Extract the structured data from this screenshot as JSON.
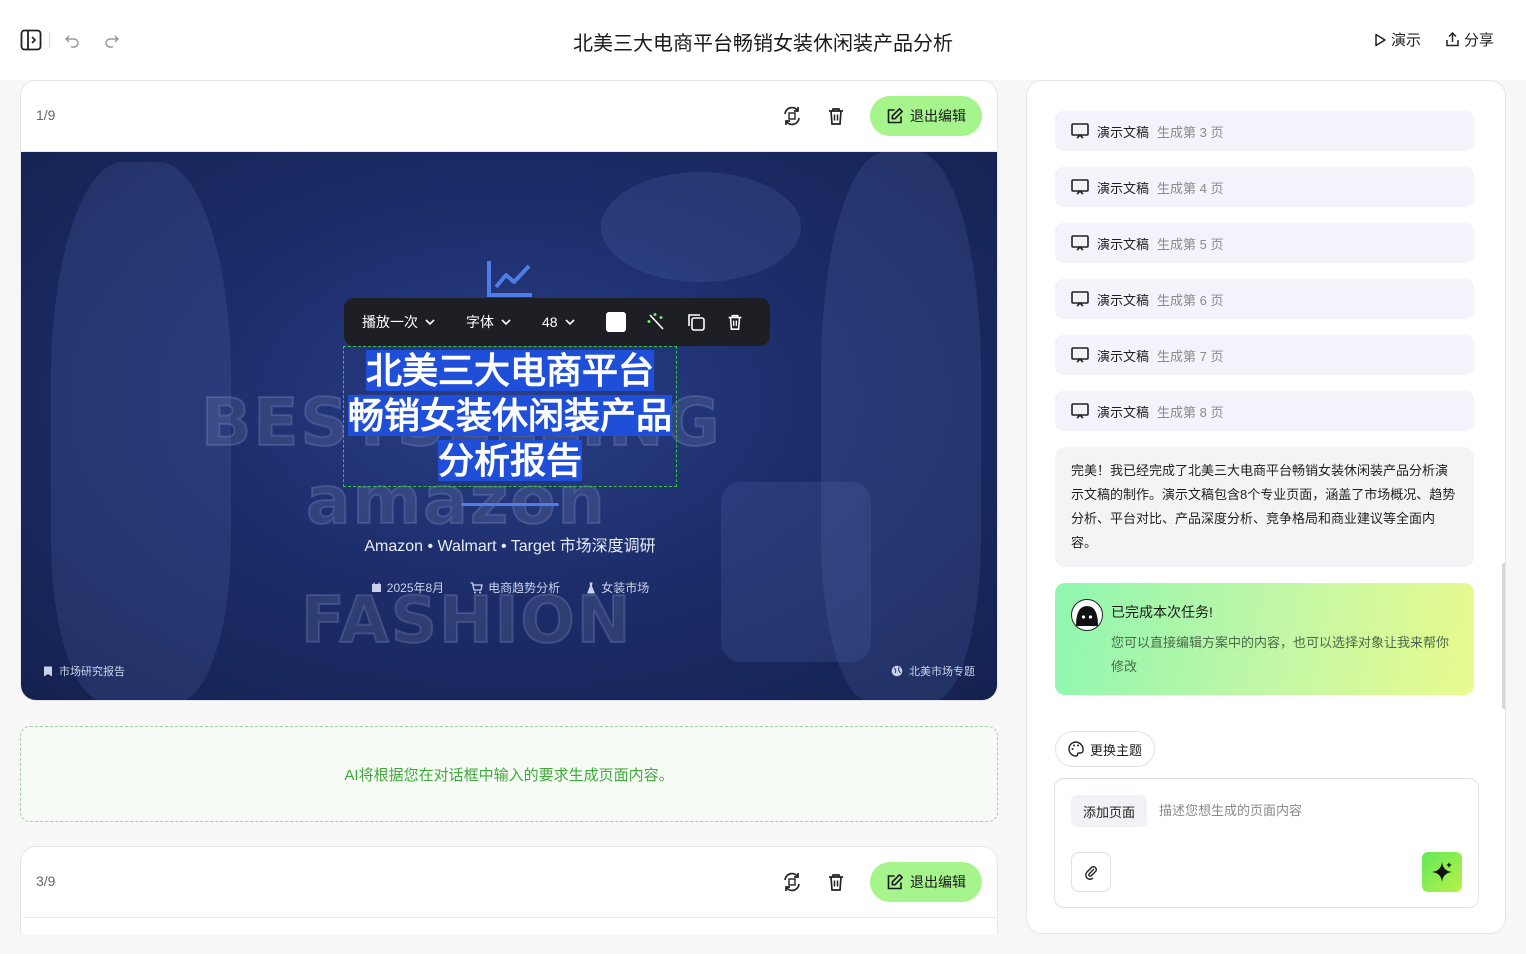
{
  "header": {
    "title": "北美三大电商平台畅销女装休闲装产品分析",
    "present_label": "演示",
    "share_label": "分享"
  },
  "slide_card_1": {
    "page_num": "1/9",
    "exit_edit_label": "退出编辑"
  },
  "slide": {
    "toolbar": {
      "animation": "播放一次",
      "font": "字体",
      "size": "48"
    },
    "title_lines": [
      "北美三大电商平台",
      "畅销女装休闲装产品",
      "分析报告"
    ],
    "bg_words": [
      "BESTSELLING",
      "amazon",
      "FASHION"
    ],
    "subtitle": "Amazon • Walmart • Target 市场深度调研",
    "meta": [
      "2025年8月",
      "电商趋势分析",
      "女装市场"
    ],
    "footer_left": "市场研究报告",
    "footer_right": "北美市场专题"
  },
  "ai_placeholder": "AI将根据您在对话框中输入的要求生成页面内容。",
  "slide_card_3": {
    "page_num": "3/9",
    "exit_edit_label": "退出编辑"
  },
  "steps": [
    {
      "label": "演示文稿",
      "detail": "生成第 3 页"
    },
    {
      "label": "演示文稿",
      "detail": "生成第 4 页"
    },
    {
      "label": "演示文稿",
      "detail": "生成第 5 页"
    },
    {
      "label": "演示文稿",
      "detail": "生成第 6 页"
    },
    {
      "label": "演示文稿",
      "detail": "生成第 7 页"
    },
    {
      "label": "演示文稿",
      "detail": "生成第 8 页"
    }
  ],
  "assistant_message": "完美！我已经完成了北美三大电商平台畅销女装休闲装产品分析演示文稿的制作。演示文稿包含8个专业页面，涵盖了市场概况、趋势分析、平台对比、产品深度分析、竞争格局和商业建议等全面内容。",
  "done": {
    "title": "已完成本次任务!",
    "text": "您可以直接编辑方案中的内容，也可以选择对象让我来帮你修改"
  },
  "theme_label": "更换主题",
  "composer": {
    "add_page_label": "添加页面",
    "placeholder": "描述您想生成的页面内容"
  },
  "colors": {
    "accent_green": "#a6f58c",
    "slide_bg": "#1c2d6a",
    "highlight": "#1f4fd8"
  }
}
